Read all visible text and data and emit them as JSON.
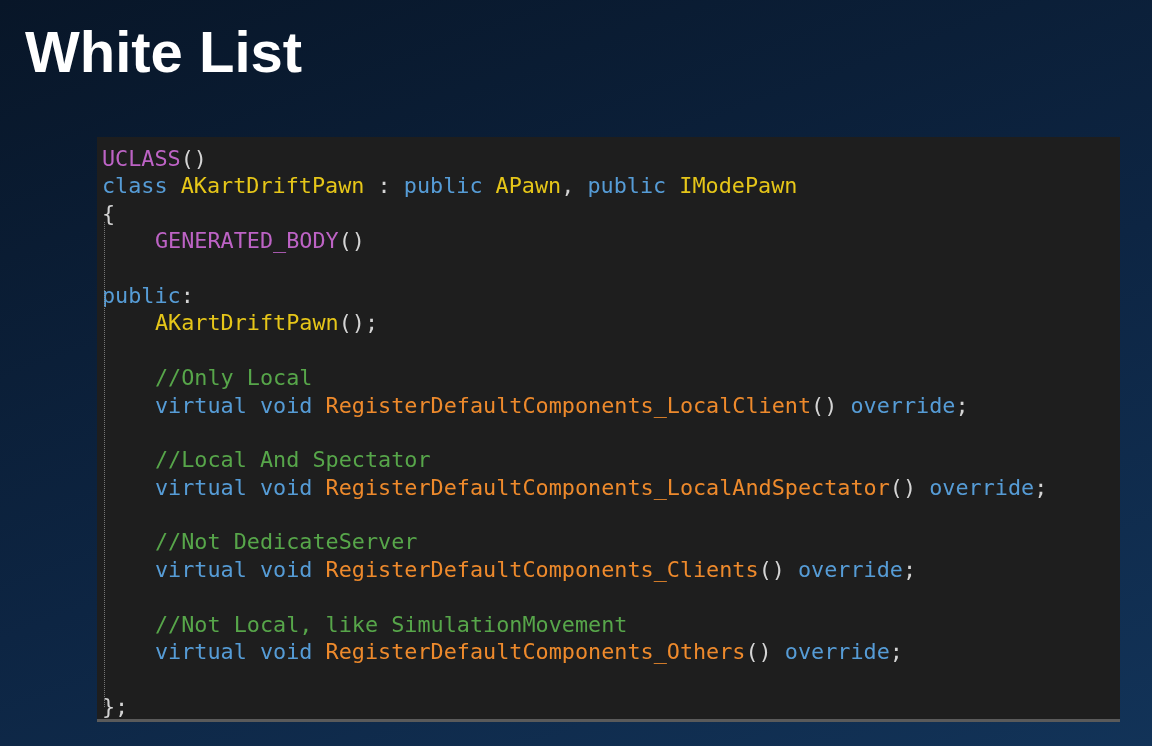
{
  "title": "White List",
  "code": {
    "lines": [
      {
        "kind": "code",
        "indented": false,
        "tokens": [
          {
            "text": "UCLASS",
            "kind": "macro",
            "joined": true
          },
          {
            "text": "()",
            "kind": "punct",
            "joined": true
          }
        ]
      },
      {
        "kind": "code",
        "indented": false,
        "tokens": [
          {
            "text": "class",
            "kind": "keyword",
            "joined": true
          },
          {
            "text": "AKartDriftPawn",
            "kind": "type",
            "joined": false
          },
          {
            "text": ":",
            "kind": "punct",
            "joined": false
          },
          {
            "text": "public",
            "kind": "keyword",
            "joined": false
          },
          {
            "text": "APawn",
            "kind": "type",
            "joined": false
          },
          {
            "text": ",",
            "kind": "punct",
            "joined": true
          },
          {
            "text": "public",
            "kind": "keyword",
            "joined": false
          },
          {
            "text": "IModePawn",
            "kind": "type",
            "joined": false
          }
        ]
      },
      {
        "kind": "code",
        "indented": false,
        "tokens": [
          {
            "text": "{",
            "kind": "punct",
            "joined": true
          }
        ]
      },
      {
        "kind": "code",
        "indented": true,
        "tokens": [
          {
            "text": "GENERATED_BODY",
            "kind": "macro",
            "joined": true
          },
          {
            "text": "()",
            "kind": "punct",
            "joined": true
          }
        ]
      },
      {
        "kind": "blank"
      },
      {
        "kind": "code",
        "indented": false,
        "tokens": [
          {
            "text": "public",
            "kind": "keyword",
            "joined": true
          },
          {
            "text": ":",
            "kind": "punct",
            "joined": true
          }
        ]
      },
      {
        "kind": "code",
        "indented": true,
        "tokens": [
          {
            "text": "AKartDriftPawn",
            "kind": "type",
            "joined": true
          },
          {
            "text": "();",
            "kind": "punct",
            "joined": true
          }
        ]
      },
      {
        "kind": "blank"
      },
      {
        "kind": "code",
        "indented": true,
        "tokens": [
          {
            "text": "//Only Local",
            "kind": "comment",
            "joined": true
          }
        ]
      },
      {
        "kind": "code",
        "indented": true,
        "tokens": [
          {
            "text": "virtual",
            "kind": "keyword",
            "joined": true
          },
          {
            "text": "void",
            "kind": "keyword",
            "joined": false
          },
          {
            "text": "RegisterDefaultComponents_LocalClient",
            "kind": "function",
            "joined": false
          },
          {
            "text": "()",
            "kind": "punct",
            "joined": true
          },
          {
            "text": "override",
            "kind": "keyword",
            "joined": false
          },
          {
            "text": ";",
            "kind": "punct",
            "joined": true
          }
        ]
      },
      {
        "kind": "blank"
      },
      {
        "kind": "code",
        "indented": true,
        "tokens": [
          {
            "text": "//Local And Spectator",
            "kind": "comment",
            "joined": true
          }
        ]
      },
      {
        "kind": "code",
        "indented": true,
        "tokens": [
          {
            "text": "virtual",
            "kind": "keyword",
            "joined": true
          },
          {
            "text": "void",
            "kind": "keyword",
            "joined": false
          },
          {
            "text": "RegisterDefaultComponents_LocalAndSpectator",
            "kind": "function",
            "joined": false
          },
          {
            "text": "()",
            "kind": "punct",
            "joined": true
          },
          {
            "text": "override",
            "kind": "keyword",
            "joined": false
          },
          {
            "text": ";",
            "kind": "punct",
            "joined": true
          }
        ]
      },
      {
        "kind": "blank"
      },
      {
        "kind": "code",
        "indented": true,
        "tokens": [
          {
            "text": "//Not DedicateServer",
            "kind": "comment",
            "joined": true
          }
        ]
      },
      {
        "kind": "code",
        "indented": true,
        "tokens": [
          {
            "text": "virtual",
            "kind": "keyword",
            "joined": true
          },
          {
            "text": "void",
            "kind": "keyword",
            "joined": false
          },
          {
            "text": "RegisterDefaultComponents_Clients",
            "kind": "function",
            "joined": false
          },
          {
            "text": "()",
            "kind": "punct",
            "joined": true
          },
          {
            "text": "override",
            "kind": "keyword",
            "joined": false
          },
          {
            "text": ";",
            "kind": "punct",
            "joined": true
          }
        ]
      },
      {
        "kind": "blank"
      },
      {
        "kind": "code",
        "indented": true,
        "tokens": [
          {
            "text": "//Not Local, like SimulationMovement",
            "kind": "comment",
            "joined": true
          }
        ]
      },
      {
        "kind": "code",
        "indented": true,
        "tokens": [
          {
            "text": "virtual",
            "kind": "keyword",
            "joined": true
          },
          {
            "text": "void",
            "kind": "keyword",
            "joined": false
          },
          {
            "text": "RegisterDefaultComponents_Others",
            "kind": "function",
            "joined": false
          },
          {
            "text": "()",
            "kind": "punct",
            "joined": true
          },
          {
            "text": "override",
            "kind": "keyword",
            "joined": false
          },
          {
            "text": ";",
            "kind": "punct",
            "joined": true
          }
        ]
      },
      {
        "kind": "blank"
      },
      {
        "kind": "code",
        "indented": false,
        "tokens": [
          {
            "text": "};",
            "kind": "punct",
            "joined": true
          }
        ]
      }
    ]
  }
}
